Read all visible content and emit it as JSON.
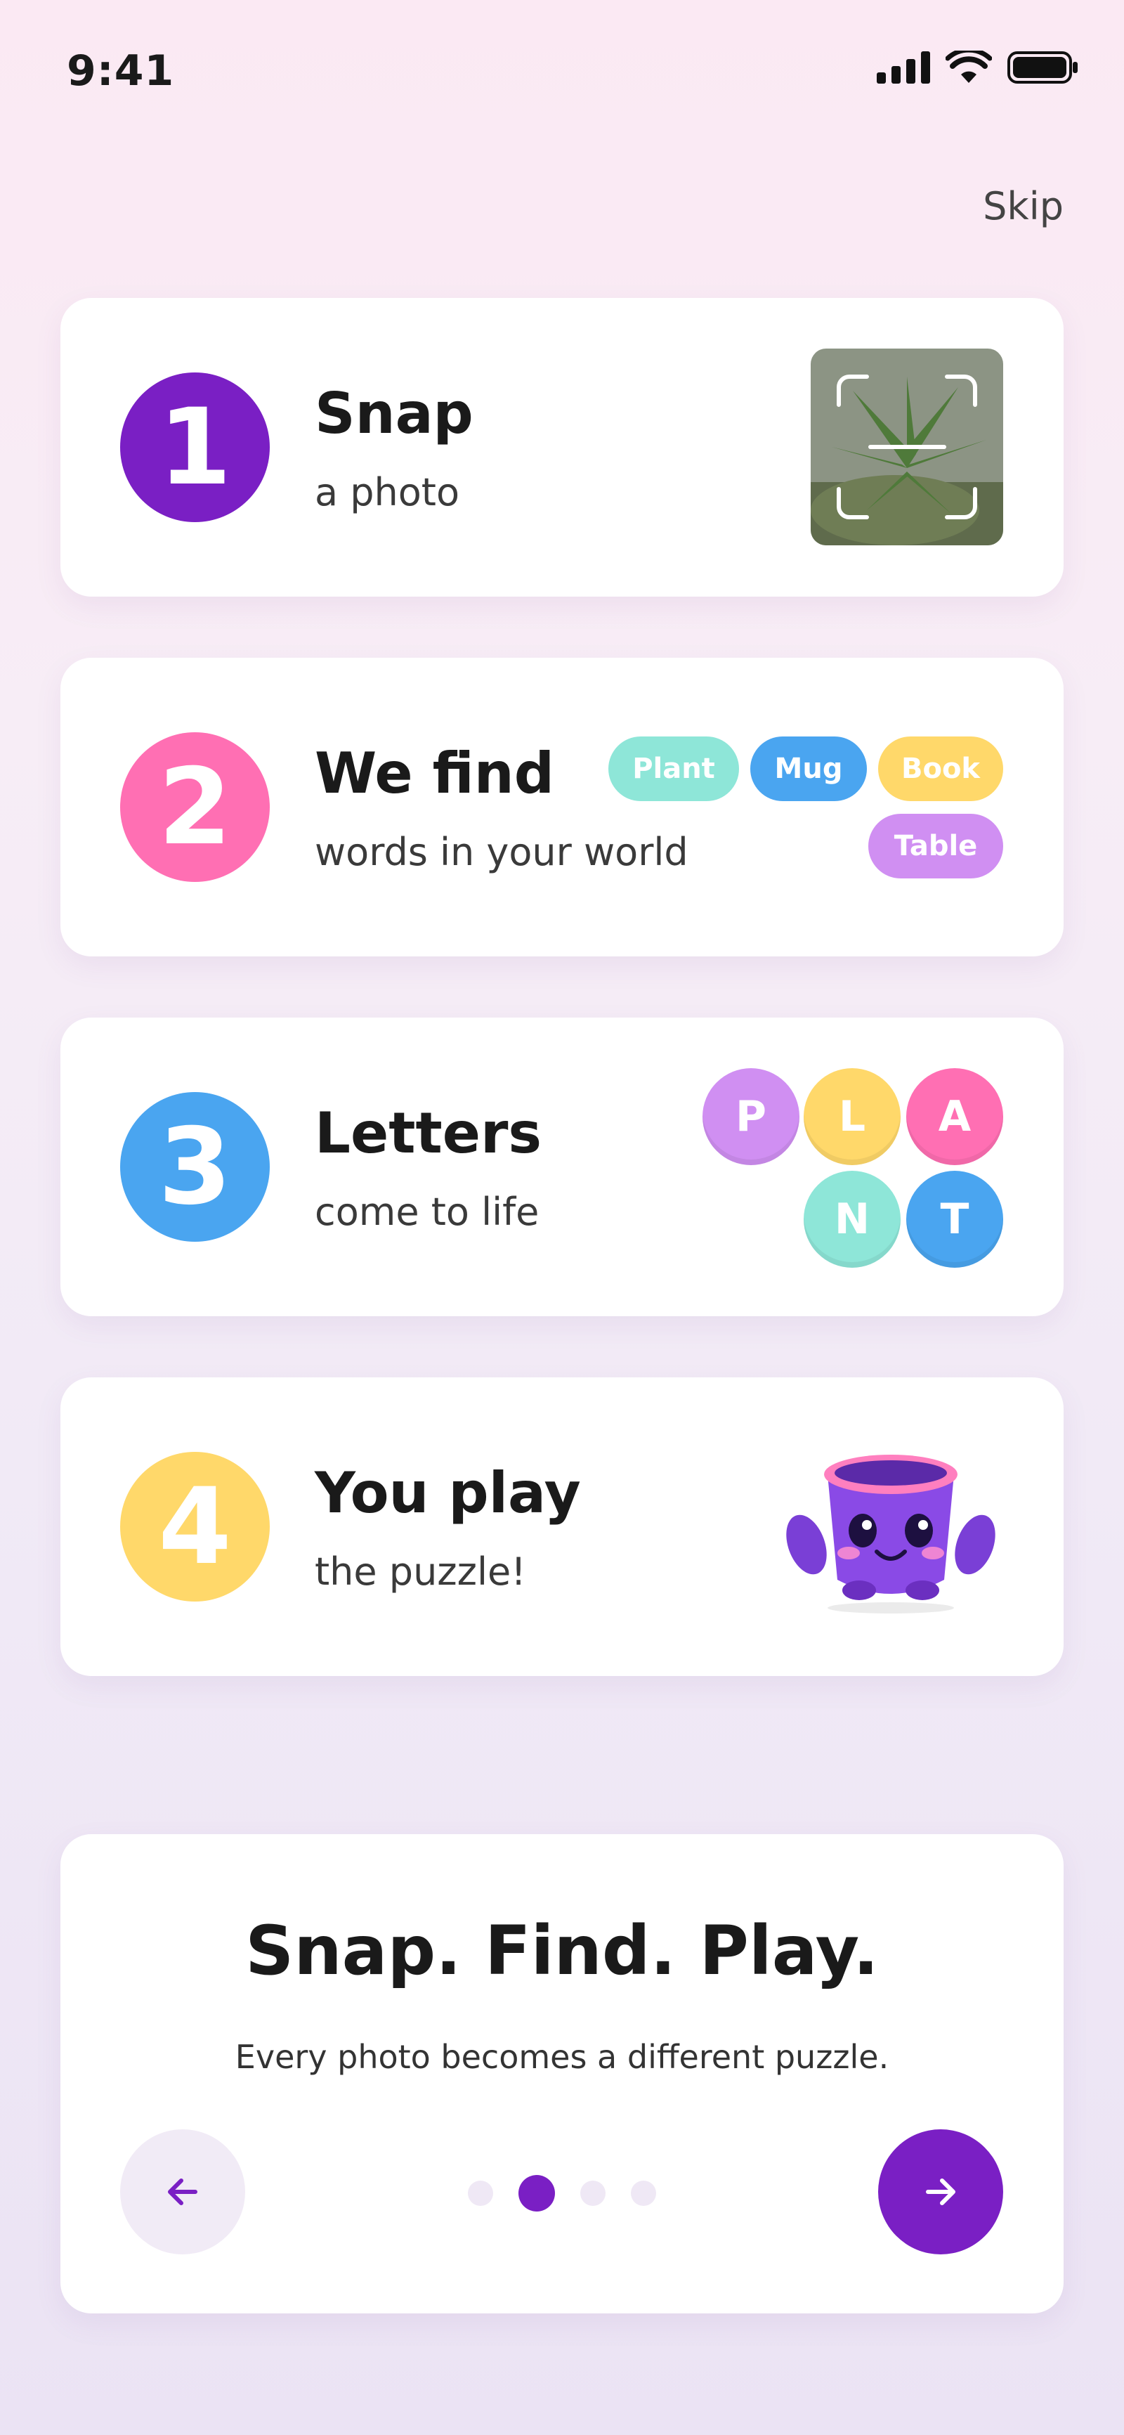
{
  "status_bar": {
    "time": "9:41"
  },
  "header": {
    "skip_label": "Skip"
  },
  "steps": [
    {
      "number": "1",
      "title": "Snap",
      "subtitle": "a photo",
      "color": "#7a1fc4"
    },
    {
      "number": "2",
      "title": "We find",
      "subtitle": "words in your world",
      "color": "#ff6fb3",
      "tags": [
        {
          "label": "Plant",
          "color": "#8ee6d8"
        },
        {
          "label": "Mug",
          "color": "#4aa5f0"
        },
        {
          "label": "Book",
          "color": "#ffd86a"
        },
        {
          "label": "Table",
          "color": "#d08ff2"
        }
      ]
    },
    {
      "number": "3",
      "title": "Letters",
      "subtitle": "come to life",
      "color": "#4aa5f0",
      "letters": [
        {
          "char": "P",
          "color": "#d08ff2"
        },
        {
          "char": "L",
          "color": "#ffd86a"
        },
        {
          "char": "A",
          "color": "#ff6fb3"
        },
        {
          "char": "N",
          "color": "#8ee6d8"
        },
        {
          "char": "T",
          "color": "#4aa5f0"
        }
      ]
    },
    {
      "number": "4",
      "title": "You play",
      "subtitle": "the puzzle!",
      "color": "#ffd86a"
    }
  ],
  "summary": {
    "headline": "Snap. Find. Play.",
    "description": "Every photo becomes a different puzzle.",
    "pagination": {
      "current_page": 2,
      "total_pages": 4
    }
  },
  "icons": {
    "signal": "signal-icon",
    "wifi": "wifi-icon",
    "battery": "battery-icon",
    "back": "arrow-left-icon",
    "next": "arrow-right-icon"
  },
  "theme": {
    "accent": "#7a1fc4"
  }
}
